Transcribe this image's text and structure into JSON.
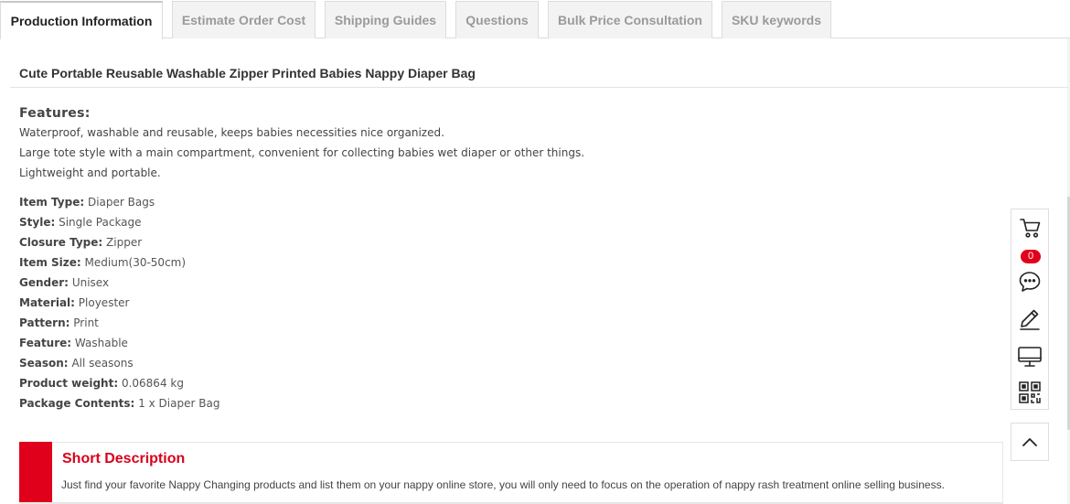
{
  "tabs": [
    {
      "label": "Production Information",
      "active": true
    },
    {
      "label": "Estimate Order Cost",
      "active": false
    },
    {
      "label": "Shipping Guides",
      "active": false
    },
    {
      "label": "Questions",
      "active": false
    },
    {
      "label": "Bulk Price Consultation",
      "active": false
    },
    {
      "label": "SKU keywords",
      "active": false
    }
  ],
  "product": {
    "title": "Cute Portable Reusable Washable Zipper Printed Babies Nappy Diaper Bag"
  },
  "features": {
    "heading": "Features:",
    "lines": [
      "Waterproof, washable and reusable, keeps babies necessities nice organized.",
      "Large tote style with a main compartment, convenient for collecting babies wet diaper or other things.",
      "Lightweight and portable."
    ]
  },
  "specs": [
    {
      "label": "Item Type:",
      "value": "Diaper Bags"
    },
    {
      "label": "Style:",
      "value": "Single Package"
    },
    {
      "label": "Closure Type:",
      "value": "Zipper"
    },
    {
      "label": "Item Size:",
      "value": "Medium(30-50cm)"
    },
    {
      "label": "Gender:",
      "value": "Unisex"
    },
    {
      "label": "Material:",
      "value": "Ployester"
    },
    {
      "label": "Pattern:",
      "value": "Print"
    },
    {
      "label": "Feature:",
      "value": "Washable"
    },
    {
      "label": "Season:",
      "value": "All seasons"
    },
    {
      "label": "Product weight:",
      "value": "0.06864 kg"
    },
    {
      "label": "Package Contents:",
      "value": "1 x Diaper Bag"
    }
  ],
  "short_description": {
    "heading": "Short Description",
    "text": "Just find your favorite Nappy Changing products and list them on your nappy online store, you will only need to focus on the operation of nappy rash treatment online selling business."
  },
  "toolbar": {
    "cart_count": "0",
    "icons": [
      "cart-icon",
      "chat-icon",
      "pencil-icon",
      "monitor-icon",
      "qr-code-icon",
      "chevron-up-icon"
    ]
  },
  "colors": {
    "accent_red": "#e0001b",
    "heading_red": "#d9001b"
  }
}
